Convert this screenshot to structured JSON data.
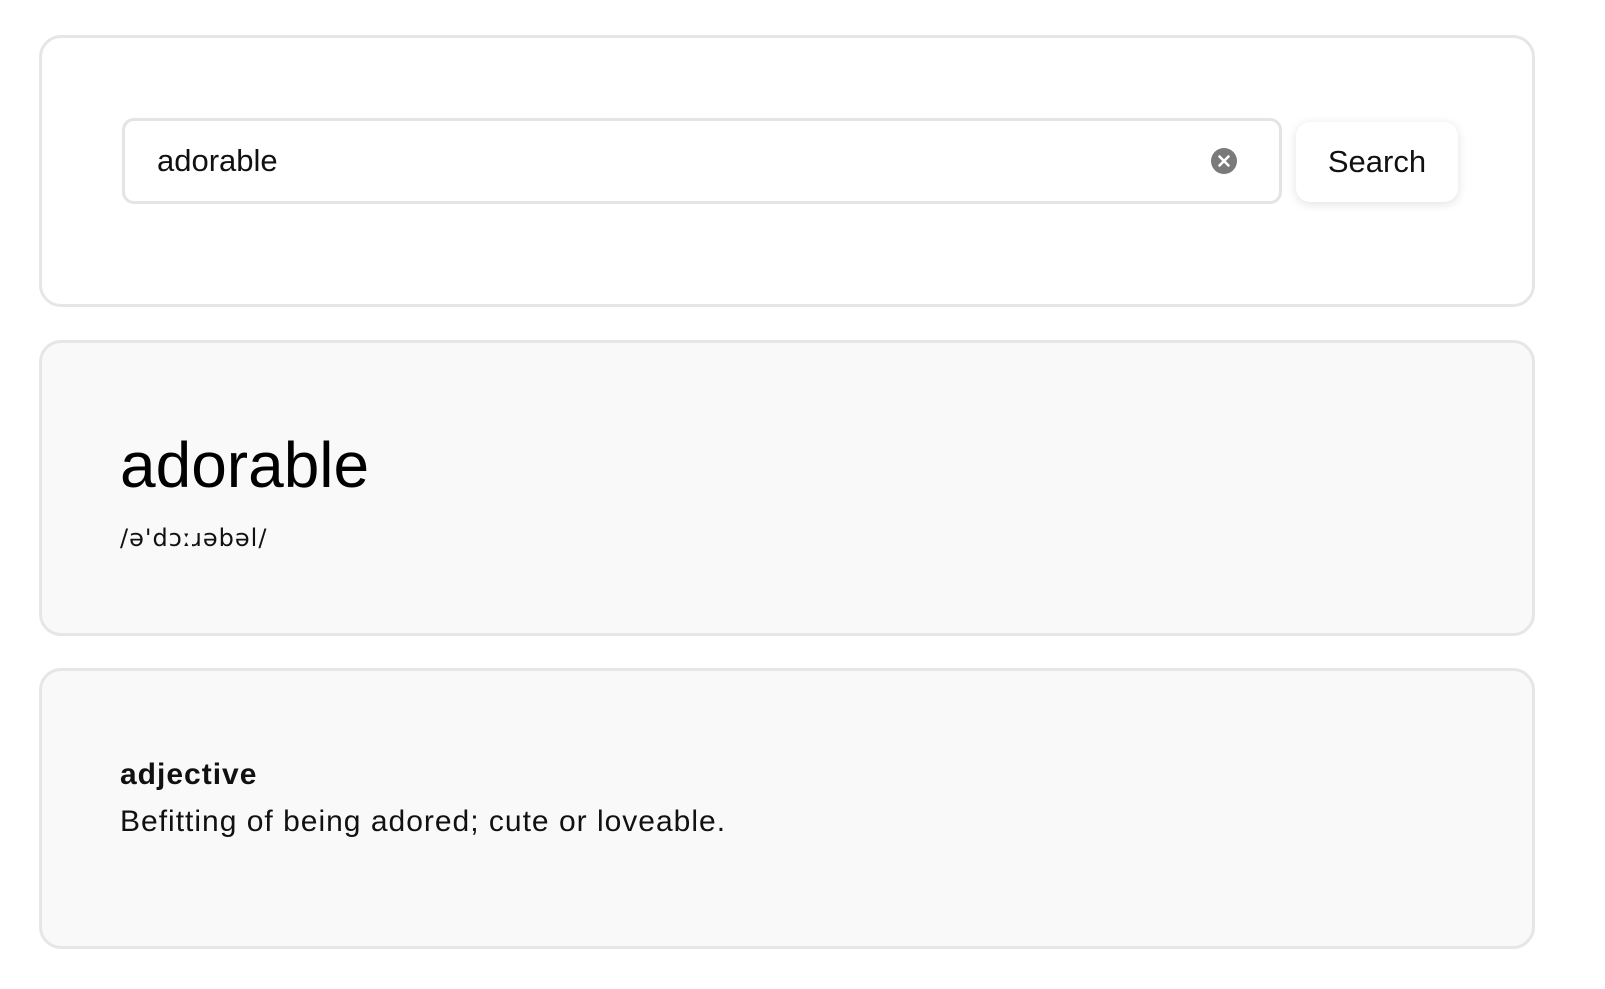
{
  "search": {
    "query": "adorable",
    "clear_icon": "clear-circle-x-icon",
    "button_label": "Search"
  },
  "entry": {
    "word": "adorable",
    "phonetic": "/ə'dɔːɹəbəl/"
  },
  "meaning": {
    "part_of_speech": "adjective",
    "definition": "Befitting of being adored; cute or loveable."
  },
  "colors": {
    "card_border": "#e6e6e6",
    "card_background": "#f9f9f9",
    "clear_icon": "#7a7a7a"
  }
}
